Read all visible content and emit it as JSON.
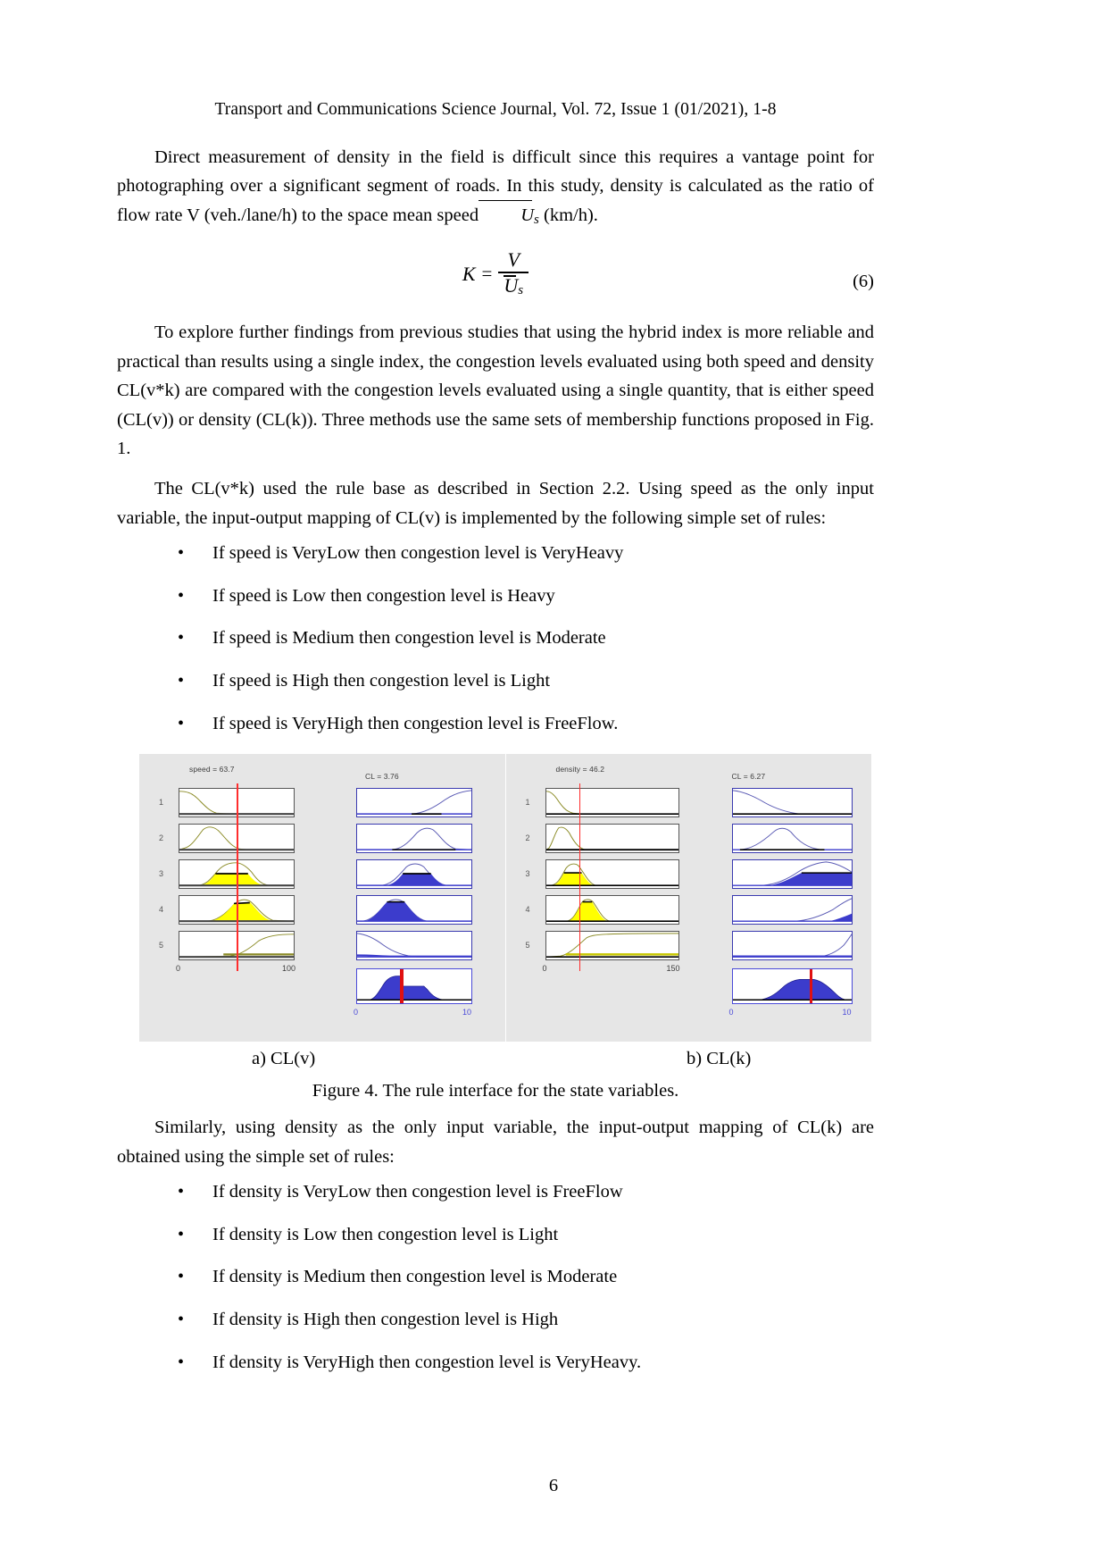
{
  "header": {
    "running_head": "Transport and Communications Science Journal, Vol. 72, Issue 1 (01/2021), 1-8"
  },
  "paragraphs": {
    "p1": "Direct measurement of density in the field is difficult since this requires a vantage point for photographing over a significant segment of roads. In this study, density is calculated as the ratio of flow rate V (veh./lane/h) to the space mean speed",
    "p1_tail": "(km/h).",
    "p2": "To explore further findings from previous studies that using the hybrid index is more reliable and practical than results using a single index, the congestion levels evaluated using both speed and density CL(v*k) are compared with the congestion levels evaluated using a single quantity, that is either speed (CL(v)) or density (CL(k)). Three methods use the same sets of membership functions proposed in Fig. 1.",
    "p3": "The CL(v*k) used the rule base as described in Section 2.2. Using speed as the only input variable, the input-output mapping of CL(v) is implemented by the following simple set of rules:",
    "p4": "Similarly, using density as the only input variable, the input-output mapping of CL(k) are obtained using the simple set of rules:"
  },
  "equation": {
    "lhs": "K",
    "equals": "=",
    "numerator": "V",
    "denominator_base": "U",
    "denominator_sub": "s",
    "number": "(6)",
    "inline_symbol": "U",
    "inline_sub": "s"
  },
  "rules_speed": {
    "bullet": "•",
    "items": [
      "If speed is VeryLow then congestion level is VeryHeavy",
      "If speed is Low then congestion level is Heavy",
      "If speed is Medium then congestion level is Moderate",
      "If speed is High then congestion level is Light",
      "If speed is VeryHigh then congestion level is FreeFlow."
    ]
  },
  "rules_density": {
    "bullet": "•",
    "items": [
      "If density is VeryLow then congestion level is FreeFlow",
      "If density is Low then congestion level is Light",
      "If density is Medium then congestion level is Moderate",
      "If density is High then congestion level is High",
      "If density is VeryHigh then congestion level is VeryHeavy."
    ]
  },
  "figure": {
    "subcaption_a": "a) CL(v)",
    "subcaption_b": "b) CL(k)",
    "caption": "Figure 4. The rule interface for the state variables.",
    "panel_a": {
      "input_title": "speed = 63.7",
      "output_title": "CL = 3.76",
      "input_axis_min": "0",
      "input_axis_max": "100",
      "output_axis_min": "0",
      "output_axis_max": "10",
      "row_labels": [
        "1",
        "2",
        "3",
        "4",
        "5"
      ]
    },
    "panel_b": {
      "input_title": "density = 46.2",
      "output_title": "CL = 6.27",
      "input_axis_min": "0",
      "input_axis_max": "150",
      "output_axis_min": "0",
      "output_axis_max": "10",
      "row_labels": [
        "1",
        "2",
        "3",
        "4",
        "5"
      ]
    },
    "colors": {
      "input_curve": "#8a8a24",
      "input_fill": "#ffff00",
      "output_curve": "#5a5ab4",
      "output_fill": "#3c3ccc",
      "indicator": "#ff2d2d",
      "background": "#e6e6e6"
    }
  },
  "footer": {
    "page_number": "6"
  }
}
